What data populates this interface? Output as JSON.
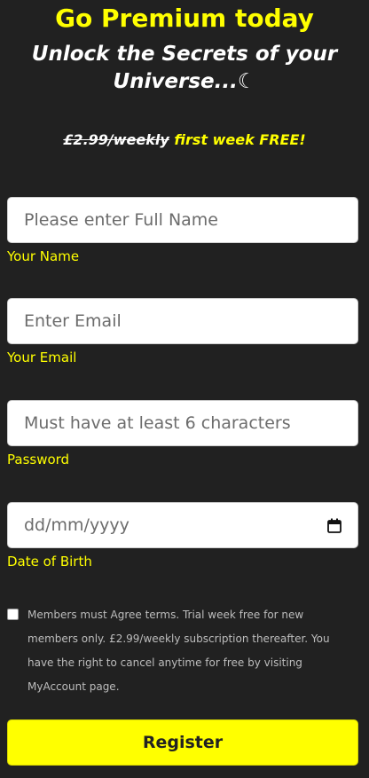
{
  "header": {
    "title": "Go Premium today",
    "subtitle": "Unlock the Secrets of your Universe...",
    "moon_icon": "☾"
  },
  "pricing": {
    "old_price": "£2.99/weekly",
    "offer": "first week FREE!"
  },
  "form": {
    "name": {
      "placeholder": "Please enter Full Name",
      "label": "Your Name"
    },
    "email": {
      "placeholder": "Enter Email",
      "label": "Your Email"
    },
    "password": {
      "placeholder": "Must have at least 6 characters",
      "label": "Password"
    },
    "dob": {
      "placeholder": "dd/mm/yyyy",
      "label": "Date of Birth",
      "icon": "calendar-icon"
    },
    "terms": {
      "checked": false,
      "text": "Members must Agree terms. Trial week free for new members only. £2.99/weekly subscription thereafter. You have the right to cancel anytime for free by visiting MyAccount page."
    },
    "register_label": "Register"
  },
  "colors": {
    "background": "#212121",
    "accent": "#ffff00",
    "text": "#ffffff",
    "muted_text": "#bdbdbd"
  }
}
